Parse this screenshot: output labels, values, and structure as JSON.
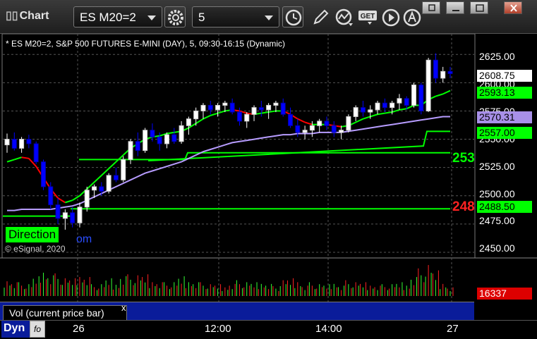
{
  "app": {
    "title": "Chart"
  },
  "toolbar": {
    "symbol_value": "ES M20=2",
    "interval_value": "5",
    "icons": [
      "gear-icon",
      "clock-icon",
      "pencil-icon",
      "line-study-icon",
      "get-icon",
      "play-icon",
      "alert-icon"
    ],
    "get_label": "GET"
  },
  "chart": {
    "header": "* ES M20=2, S&P 500 FUTURES E-MINI (DAY), 5, 09:30-16:15 (Dynamic)",
    "copyright": "© eSignal, 2020",
    "direction_label": "Direction",
    "direction_link": "om",
    "price_tags": {
      "last": "2608.75",
      "ma_fast": "2593.13",
      "ma_slow": "2570.31",
      "level_high": "2557.00",
      "level_low": "2488.50"
    },
    "line_labels": {
      "upper": "253",
      "lower": "248"
    },
    "colors": {
      "up": "#ffffff",
      "down": "#0000ff",
      "ma_green": "#00ff00",
      "ma_red": "#ff0000",
      "ma_purple": "#b79cff",
      "grid": "#555555"
    }
  },
  "volume": {
    "legend": "Vol (current price bar)",
    "close_label": "x",
    "last_value": "16337"
  },
  "footer": {
    "dyn_label": "Dyn",
    "fx_label": "fo"
  },
  "chart_data": {
    "type": "candlestick",
    "y_axis": {
      "ticks": [
        "2625.00",
        "2600.00",
        "2575.00",
        "2550.00",
        "2525.00",
        "2500.00",
        "2475.00",
        "2450.00"
      ],
      "range": [
        2445,
        2632
      ]
    },
    "x_axis": {
      "ticks": [
        "26",
        "12:00",
        "14:00",
        "27"
      ]
    },
    "candles": [
      [
        2545,
        2555,
        2538,
        2550
      ],
      [
        2550,
        2556,
        2540,
        2542
      ],
      [
        2542,
        2552,
        2538,
        2550
      ],
      [
        2550,
        2554,
        2542,
        2546
      ],
      [
        2546,
        2548,
        2528,
        2530
      ],
      [
        2530,
        2532,
        2505,
        2508
      ],
      [
        2508,
        2512,
        2488,
        2492
      ],
      [
        2492,
        2498,
        2475,
        2480
      ],
      [
        2480,
        2488,
        2470,
        2485
      ],
      [
        2485,
        2490,
        2472,
        2476
      ],
      [
        2476,
        2494,
        2472,
        2490
      ],
      [
        2490,
        2508,
        2486,
        2505
      ],
      [
        2505,
        2510,
        2498,
        2508
      ],
      [
        2508,
        2512,
        2500,
        2504
      ],
      [
        2504,
        2520,
        2502,
        2518
      ],
      [
        2518,
        2525,
        2512,
        2514
      ],
      [
        2514,
        2535,
        2512,
        2532
      ],
      [
        2532,
        2550,
        2528,
        2548
      ],
      [
        2548,
        2556,
        2535,
        2540
      ],
      [
        2540,
        2560,
        2538,
        2558
      ],
      [
        2558,
        2564,
        2548,
        2552
      ],
      [
        2552,
        2556,
        2540,
        2546
      ],
      [
        2546,
        2556,
        2542,
        2554
      ],
      [
        2554,
        2560,
        2546,
        2548
      ],
      [
        2548,
        2566,
        2546,
        2562
      ],
      [
        2562,
        2570,
        2554,
        2568
      ],
      [
        2568,
        2578,
        2562,
        2575
      ],
      [
        2575,
        2582,
        2568,
        2580
      ],
      [
        2580,
        2584,
        2572,
        2576
      ],
      [
        2576,
        2582,
        2570,
        2580
      ],
      [
        2580,
        2584,
        2574,
        2582
      ],
      [
        2582,
        2586,
        2572,
        2574
      ],
      [
        2574,
        2578,
        2562,
        2566
      ],
      [
        2566,
        2574,
        2560,
        2572
      ],
      [
        2572,
        2580,
        2566,
        2578
      ],
      [
        2578,
        2584,
        2570,
        2576
      ],
      [
        2576,
        2582,
        2568,
        2580
      ],
      [
        2580,
        2584,
        2574,
        2582
      ],
      [
        2582,
        2586,
        2570,
        2572
      ],
      [
        2572,
        2578,
        2560,
        2562
      ],
      [
        2562,
        2568,
        2552,
        2556
      ],
      [
        2556,
        2562,
        2550,
        2558
      ],
      [
        2558,
        2566,
        2552,
        2562
      ],
      [
        2562,
        2568,
        2556,
        2566
      ],
      [
        2566,
        2570,
        2558,
        2562
      ],
      [
        2562,
        2566,
        2552,
        2556
      ],
      [
        2556,
        2562,
        2550,
        2558
      ],
      [
        2558,
        2572,
        2556,
        2570
      ],
      [
        2570,
        2580,
        2566,
        2578
      ],
      [
        2578,
        2584,
        2570,
        2574
      ],
      [
        2574,
        2580,
        2568,
        2576
      ],
      [
        2576,
        2584,
        2572,
        2582
      ],
      [
        2582,
        2586,
        2574,
        2578
      ],
      [
        2578,
        2584,
        2572,
        2582
      ],
      [
        2582,
        2590,
        2576,
        2586
      ],
      [
        2586,
        2588,
        2576,
        2580
      ],
      [
        2580,
        2600,
        2578,
        2598
      ],
      [
        2598,
        2600,
        2572,
        2575
      ],
      [
        2575,
        2622,
        2574,
        2620
      ],
      [
        2620,
        2626,
        2600,
        2604
      ],
      [
        2604,
        2614,
        2600,
        2610
      ],
      [
        2610,
        2614,
        2604,
        2608
      ]
    ],
    "ma_fast": [
      2530,
      2532,
      2534,
      2533,
      2526,
      2516,
      2506,
      2498,
      2494,
      2496,
      2500,
      2506,
      2512,
      2518,
      2524,
      2530,
      2536,
      2542,
      2546,
      2550,
      2552,
      2553,
      2555,
      2556,
      2557,
      2560,
      2564,
      2568,
      2571,
      2573,
      2575,
      2576,
      2575,
      2573,
      2572,
      2573,
      2574,
      2575,
      2575,
      2572,
      2568,
      2565,
      2563,
      2563,
      2563,
      2562,
      2561,
      2562,
      2565,
      2568,
      2570,
      2572,
      2573,
      2574,
      2576,
      2577,
      2580,
      2580,
      2585,
      2588,
      2590,
      2593
    ],
    "ma_slow": [
      2487,
      2487,
      2488,
      2488,
      2488,
      2488,
      2488,
      2489,
      2490,
      2491,
      2493,
      2496,
      2499,
      2502,
      2505,
      2508,
      2511,
      2514,
      2517,
      2520,
      2522,
      2524,
      2526,
      2528,
      2530,
      2533,
      2536,
      2539,
      2541,
      2543,
      2545,
      2547,
      2548,
      2549,
      2550,
      2551,
      2552,
      2553,
      2554,
      2554,
      2555,
      2555,
      2555,
      2556,
      2556,
      2556,
      2556,
      2557,
      2558,
      2559,
      2560,
      2561,
      2562,
      2563,
      2564,
      2565,
      2566,
      2567,
      2568,
      2569,
      2570,
      2570
    ],
    "levels": {
      "upper_step": [
        2535,
        2557
      ],
      "green_lower": 2488.5
    },
    "volume_last": 16337
  }
}
